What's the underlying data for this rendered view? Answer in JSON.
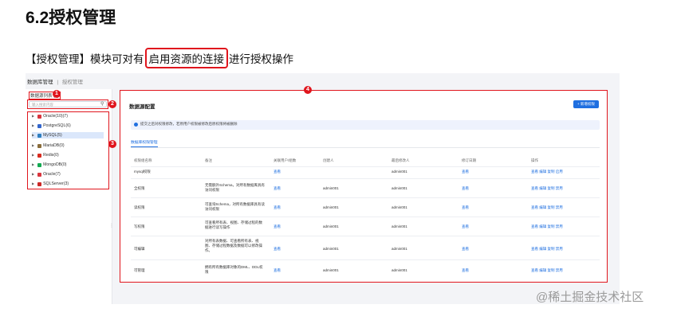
{
  "doc": {
    "title": "6.2授权管理",
    "intro_before": "【授权管理】模块可对有",
    "intro_highlight": "启用资源的连接",
    "intro_after": "进行授权操作"
  },
  "breadcrumb": {
    "main": "数据库管理",
    "sep": "|",
    "sub": "授权管理"
  },
  "left": {
    "list_label": "数据源列表 (8)",
    "search_placeholder": "输入搜索内容",
    "tree": [
      {
        "label": "Oracle(10)(7)",
        "color": "#d9363e"
      },
      {
        "label": "PostgreSQL(6)",
        "color": "#3366cc"
      },
      {
        "label": "MySQL(5)",
        "color": "#2f7fc1"
      },
      {
        "label": "MariaDB(0)",
        "color": "#8a6d3b"
      },
      {
        "label": "Redis(0)",
        "color": "#d82c20"
      },
      {
        "label": "MongoDB(0)",
        "color": "#13aa52"
      },
      {
        "label": "Oracle(7)",
        "color": "#d9363e"
      },
      {
        "label": "SQLServer(3)",
        "color": "#cc2927"
      }
    ]
  },
  "badges": [
    "1",
    "2",
    "3",
    "4"
  ],
  "main": {
    "title": "数据源配置",
    "add_button": "+ 新增权限",
    "info": "提交之后对权限修改，若原用户权限被修改后原权限将被删除",
    "tab": "数据库权限管理",
    "columns": [
      "权限组名称",
      "备注",
      "关联用户/组数",
      "创建人",
      "最后修改人",
      "修订日期",
      "操作"
    ],
    "rows": [
      {
        "name": "mysql权限",
        "note": "",
        "users": "查看",
        "creator": "",
        "modifier": "admin001",
        "date": "查看",
        "actions": "查看 编辑 复制 启用"
      },
      {
        "name": "全权限",
        "note": "无需额外Schema，对所有数据库具有访问权限",
        "users": "查看",
        "creator": "admin001",
        "modifier": "admin001",
        "date": "查看",
        "actions": "查看 编辑 复制 禁用"
      },
      {
        "name": "读权限",
        "note": "可查询Schema，对所有数据库具有读访问权限",
        "users": "查看",
        "creator": "admin001",
        "modifier": "admin001",
        "date": "查看",
        "actions": "查看 编辑 复制 禁用"
      },
      {
        "name": "写权限",
        "note": "可查看所有表、视图、存储过程的数据进行读写操作",
        "users": "查看",
        "creator": "admin001",
        "modifier": "admin001",
        "date": "查看",
        "actions": "查看 编辑 复制 禁用"
      },
      {
        "name": "可编辑",
        "note": "对所有表数据、可查看所有表、视图、存储过程数据及数据可以修改操作。",
        "users": "查看",
        "creator": "admin001",
        "modifier": "admin001",
        "date": "查看",
        "actions": "查看 编辑 复制 禁用"
      },
      {
        "name": "可管理",
        "note": "拥有所有数据库对象的DML、DDL权限",
        "users": "查看",
        "creator": "admin001",
        "modifier": "admin001",
        "date": "查看",
        "actions": "查看 编辑 复制 禁用"
      }
    ]
  },
  "watermark": "@稀土掘金技术社区",
  "colors": {
    "accent": "#1f6fe0",
    "annotation": "#e0151d"
  }
}
